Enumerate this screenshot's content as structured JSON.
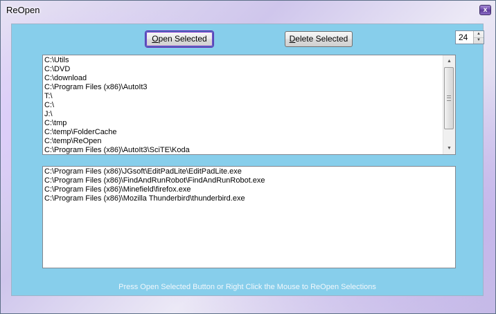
{
  "window": {
    "title": "ReOpen",
    "close_label": "x"
  },
  "toolbar": {
    "open_label_prefix": "O",
    "open_label_rest": "pen Selected",
    "delete_label_prefix": "D",
    "delete_label_rest": "elete Selected",
    "count_value": "24"
  },
  "folders": {
    "items": [
      "C:\\Utils",
      "C:\\DVD",
      "C:\\download",
      "C:\\Program Files (x86)\\AutoIt3",
      "T:\\",
      "C:\\",
      "J:\\",
      "C:\\tmp",
      "C:\\temp\\FolderCache",
      "C:\\temp\\ReOpen",
      "C:\\Program Files (x86)\\AutoIt3\\SciTE\\Koda"
    ]
  },
  "programs": {
    "items": [
      "C:\\Program Files (x86)\\JGsoft\\EditPadLite\\EditPadLite.exe",
      "C:\\Program Files (x86)\\FindAndRunRobot\\FindAndRunRobot.exe",
      "C:\\Program Files (x86)\\Minefield\\firefox.exe",
      "C:\\Program Files (x86)\\Mozilla Thunderbird\\thunderbird.exe"
    ]
  },
  "status": {
    "hint": "Press Open Selected Button or Right Click the Mouse to ReOpen Selections"
  },
  "colors": {
    "client_background": "#87ceeb",
    "focus_border": "#6a1fb8"
  }
}
